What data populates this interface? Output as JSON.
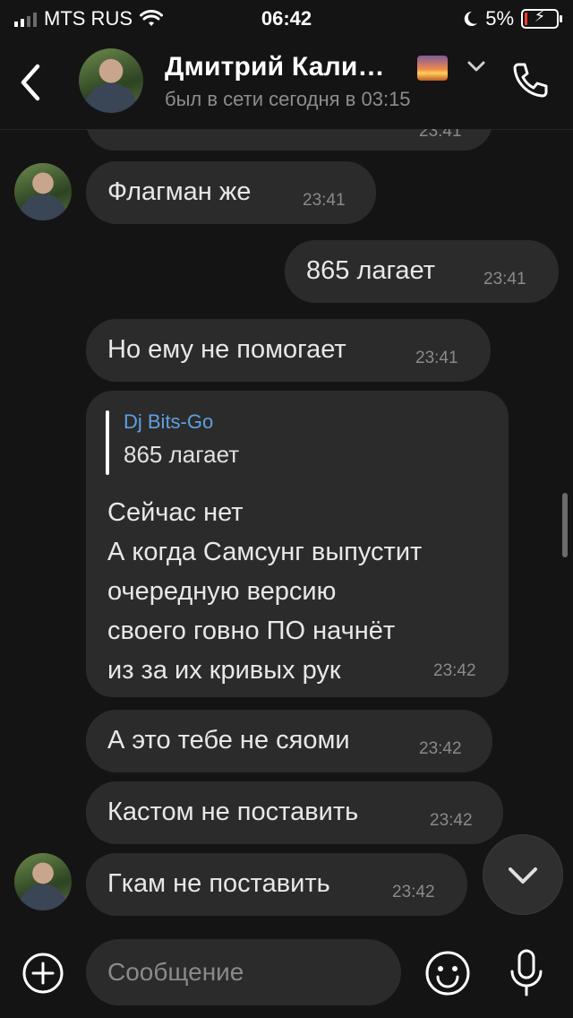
{
  "status_bar": {
    "carrier": "MTS RUS",
    "time": "06:42",
    "battery": "5%"
  },
  "header": {
    "name": "Дмитрий Кали…",
    "status": "был в сети сегодня в 03:15"
  },
  "messages": [
    {
      "id": "partial",
      "text": "",
      "time": "23:41"
    },
    {
      "id": "m1",
      "text": "Флагман же",
      "time": "23:41",
      "outgoing": false
    },
    {
      "id": "m2",
      "text": "865 лагает",
      "time": "23:41",
      "outgoing": true
    },
    {
      "id": "m3",
      "text": "Но ему не помогает",
      "time": "23:41",
      "outgoing": false
    },
    {
      "id": "m4",
      "reply_author": "Dj Bits-Go",
      "reply_text": "865 лагает",
      "text": "Сейчас нет\nА когда Самсунг выпустит\nочередную версию\nсвоего говно ПО начнёт\nиз за их кривых рук",
      "time": "23:42",
      "outgoing": false
    },
    {
      "id": "m5",
      "text": "А это тебе не сяоми",
      "time": "23:42",
      "outgoing": false
    },
    {
      "id": "m6",
      "text": "Кастом не поставить",
      "time": "23:42",
      "outgoing": false
    },
    {
      "id": "m7",
      "text": "Гкам не поставить",
      "time": "23:42",
      "outgoing": false
    }
  ],
  "composer": {
    "placeholder": "Сообщение"
  },
  "colors": {
    "bubble": "#2b2b2b",
    "background": "#141414",
    "reply_author": "#5ea0e0"
  }
}
